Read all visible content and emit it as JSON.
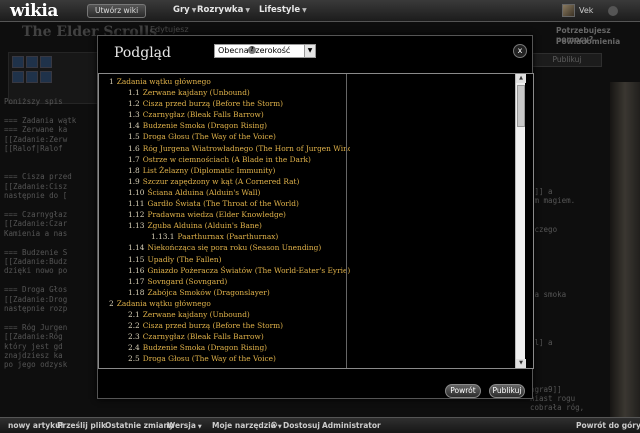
{
  "topnav": {
    "logo": "wikia",
    "create_wiki": "Utwórz wiki",
    "links": [
      {
        "label": "Gry"
      },
      {
        "label": "Rozrywka"
      },
      {
        "label": "Lifestyle"
      }
    ],
    "user": "Vek"
  },
  "editor": {
    "wiki_title": "The Elder Scrolls",
    "edit_label": "Edytujesz",
    "help": "Potrzebujesz pomocy?",
    "preferences": "Powiadomienia",
    "publish": "Publikuj",
    "text_lines": [
      "Poniższy spis",
      "",
      "=== Zadania wątk",
      "=== Zerwane ka",
      "[[Zadanie:Zerw",
      "[[Ralof|Ralof",
      "",
      "",
      "=== Cisza przed",
      "[[Zadanie:Cisz",
      "następnie do [",
      "",
      "=== Czarnygłaz",
      "[[Zadanie:Czar",
      "Kamienia a nas",
      "",
      "=== Budzenie S",
      "[[Zadanie:Budz",
      "dzięki nowo po",
      "",
      "=== Droga Głos",
      "[[Zadanie:Drog",
      "następnie rozp",
      "",
      "=== Róg Jurgen",
      "[[Zadanie:Róg",
      "który jest gd",
      "znajdziesz ka",
      "po jego odzysk"
    ],
    "text_lines_right": [
      "y]] a",
      "ym magiem.",
      "",
      "",
      "oczego",
      "",
      "",
      "",
      "",
      "",
      "",
      "ia smoka",
      "",
      "",
      "",
      "",
      "al] a",
      "",
      "",
      "",
      "",
      "ngra9]]",
      "niast rogu",
      "cobrała róg,"
    ]
  },
  "modal": {
    "title": "Podgląd",
    "width_select": "Obecna szerokość",
    "help_icon": "?",
    "close": "x",
    "back_button": "Powrót",
    "publish_button": "Publikuj",
    "toc": [
      {
        "level": 1,
        "num": "1",
        "text": "Zadania wątku głównego"
      },
      {
        "level": 2,
        "num": "1.1",
        "text": "Zerwane kajdany (Unbound)"
      },
      {
        "level": 2,
        "num": "1.2",
        "text": "Cisza przed burzą (Before the Storm)"
      },
      {
        "level": 2,
        "num": "1.3",
        "text": "Czarnygłaz (Bleak Falls Barrow)"
      },
      {
        "level": 2,
        "num": "1.4",
        "text": "Budzenie Smoka (Dragon Rising)"
      },
      {
        "level": 2,
        "num": "1.5",
        "text": "Droga Głosu (The Way of the Voice)"
      },
      {
        "level": 2,
        "num": "1.6",
        "text": "Róg Jurgena Wiatrowładnego (The Horn of Jurgen Windcaller)"
      },
      {
        "level": 2,
        "num": "1.7",
        "text": "Ostrze w ciemnościach (A Blade in the Dark)"
      },
      {
        "level": 2,
        "num": "1.8",
        "text": "List Żelazny (Diplomatic Immunity)"
      },
      {
        "level": 2,
        "num": "1.9",
        "text": "Szczur zapędzony w kąt (A Cornered Rat)"
      },
      {
        "level": 2,
        "num": "1.10",
        "text": "Ściana Alduina (Alduin's Wall)"
      },
      {
        "level": 2,
        "num": "1.11",
        "text": "Gardło Świata (The Throat of the World)"
      },
      {
        "level": 2,
        "num": "1.12",
        "text": "Pradawna wiedza (Elder Knowledge)"
      },
      {
        "level": 2,
        "num": "1.13",
        "text": "Zguba Alduina (Alduin's Bane)"
      },
      {
        "level": 3,
        "num": "1.13.1",
        "text": "Paarthurnax (Paarthurnax)"
      },
      {
        "level": 2,
        "num": "1.14",
        "text": "Niekończąca się pora roku (Season Unending)"
      },
      {
        "level": 2,
        "num": "1.15",
        "text": "Upadły (The Fallen)"
      },
      {
        "level": 2,
        "num": "1.16",
        "text": "Gniazdo Pożeracza Światów (The World-Eater's Eyrie)"
      },
      {
        "level": 2,
        "num": "1.17",
        "text": "Sovngard (Sovngard)"
      },
      {
        "level": 2,
        "num": "1.18",
        "text": "Zabójca Smoków (Dragonslayer)"
      },
      {
        "level": 1,
        "num": "2",
        "text": "Zadania wątku głównego"
      },
      {
        "level": 2,
        "num": "2.1",
        "text": "Zerwane kajdany (Unbound)"
      },
      {
        "level": 2,
        "num": "2.2",
        "text": "Cisza przed burzą (Before the Storm)"
      },
      {
        "level": 2,
        "num": "2.3",
        "text": "Czarnygłaz (Bleak Falls Barrow)"
      },
      {
        "level": 2,
        "num": "2.4",
        "text": "Budzenie Smoka (Dragon Rising)"
      },
      {
        "level": 2,
        "num": "2.5",
        "text": "Droga Głosu (The Way of the Voice)"
      }
    ]
  },
  "bottombar": {
    "items": [
      {
        "label": "nowy artykuł"
      },
      {
        "label": "Prześlij plik"
      },
      {
        "label": "Ostatnie zmiany"
      },
      {
        "label": "Wersja"
      },
      {
        "label": "Moje narzędzia"
      },
      {
        "label": "Dostosuj"
      },
      {
        "label": "Administrator"
      }
    ],
    "to_top": "Powrót do góry"
  },
  "colors": {
    "toc_link": "#e0b24a",
    "background": "#000000"
  }
}
